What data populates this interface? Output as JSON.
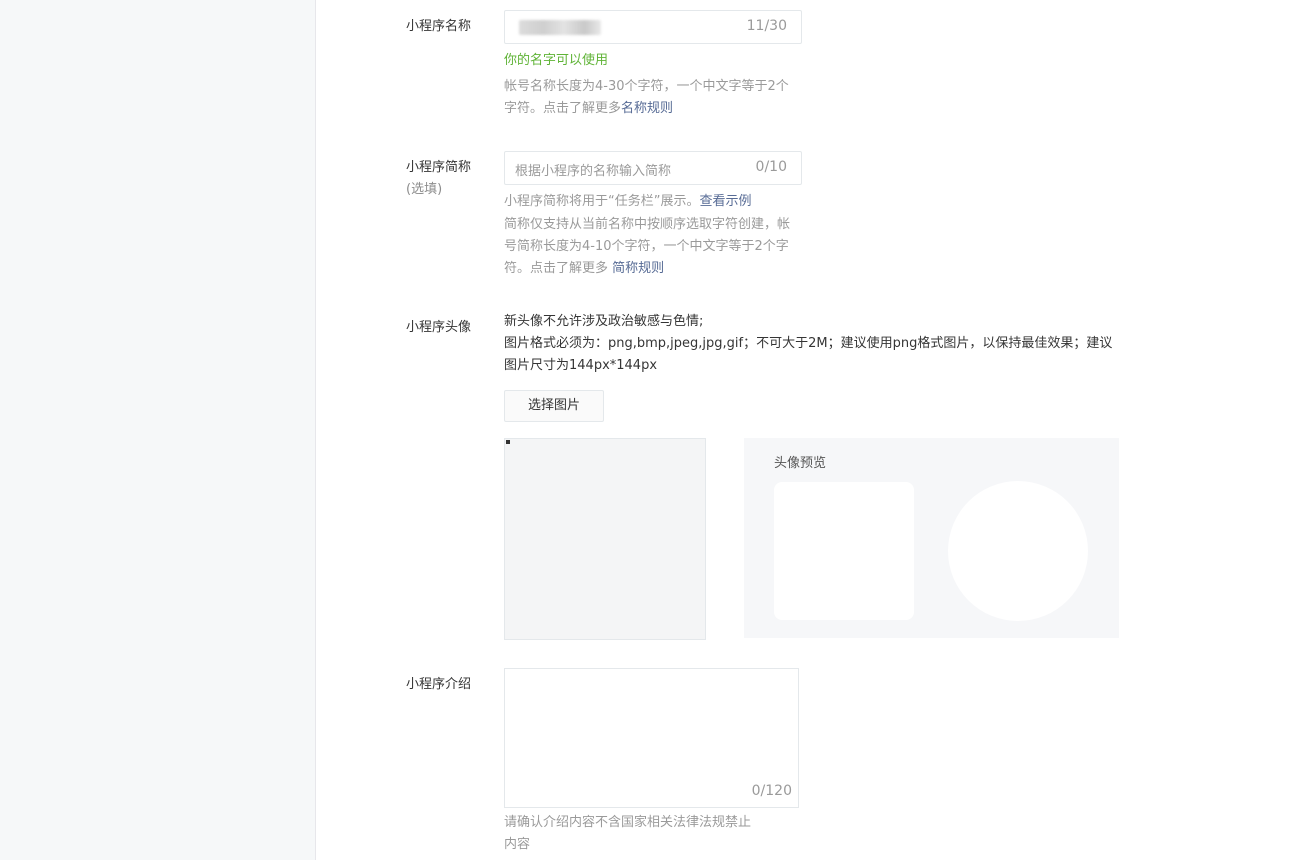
{
  "form": {
    "name": {
      "label": "小程序名称",
      "count": "11/30",
      "status": "你的名字可以使用",
      "hint_text": "帐号名称长度为4-30个字符，一个中文字等于2个字符。点击了解更多",
      "hint_link": "名称规则"
    },
    "short_name": {
      "label": "小程序简称",
      "label_sub": "(选填)",
      "placeholder": "根据小程序的名称输入简称",
      "count": "0/10",
      "hint1_text": "小程序简称将用于“任务栏”展示。",
      "hint1_link": "查看示例",
      "hint2_text": "简称仅支持从当前名称中按顺序选取字符创建，帐号简称长度为4-10个字符，一个中文字等于2个字符。点击了解更多 ",
      "hint2_link": "简称规则"
    },
    "avatar": {
      "label": "小程序头像",
      "desc_line1": "新头像不允许涉及政治敏感与色情;",
      "desc_line2": "图片格式必须为：png,bmp,jpeg,jpg,gif；不可大于2M；建议使用png格式图片，以保持最佳效果；建议图片尺寸为144px*144px",
      "select_button": "选择图片",
      "preview_title": "头像预览"
    },
    "intro": {
      "label": "小程序介绍",
      "count": "0/120",
      "hint": "请确认介绍内容不含国家相关法律法规禁止内容"
    }
  }
}
